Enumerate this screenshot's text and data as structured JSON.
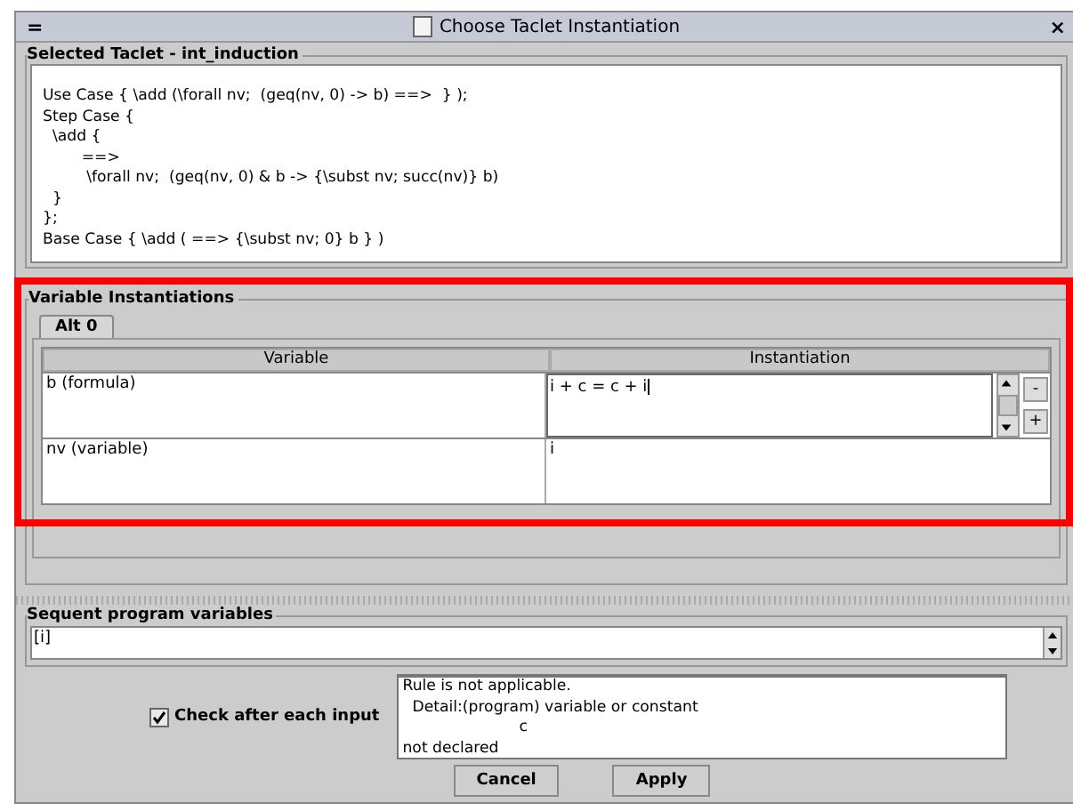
{
  "window": {
    "title": "Choose Taclet Instantiation",
    "menu_glyph": "=",
    "close_glyph": "×"
  },
  "selected_taclet": {
    "title": "Selected Taclet - int_induction",
    "lines": [
      "Use Case { \\add (\\forall nv;  (geq(nv, 0) -> b) ==>  } );",
      "Step Case {",
      "  \\add {",
      "        ==>",
      "         \\forall nv;  (geq(nv, 0) & b -> {\\subst nv; succ(nv)} b)",
      "  }",
      "};",
      "Base Case { \\add ( ==> {\\subst nv; 0} b } )"
    ]
  },
  "variable_instantiations": {
    "title": "Variable Instantiations",
    "tabs": [
      {
        "label": "Alt 0",
        "selected": true
      }
    ],
    "columns": [
      "Variable",
      "Instantiation"
    ],
    "rows": [
      {
        "variable": "b (formula)",
        "instantiation": "i + c = c + i",
        "editing": true,
        "minus": "-",
        "plus": "+"
      },
      {
        "variable": "nv (variable)",
        "instantiation": "i",
        "editing": false
      }
    ]
  },
  "sequent_program_variables": {
    "title": "Sequent program variables",
    "value": "[i]"
  },
  "check_after_each_input": {
    "label": "Check after each input",
    "checked": true
  },
  "message": {
    "lines": [
      "Rule is not applicable.",
      "  Detail:(program) variable or constant",
      "                        c",
      "not declared"
    ]
  },
  "buttons": [
    "Cancel",
    "Apply"
  ]
}
